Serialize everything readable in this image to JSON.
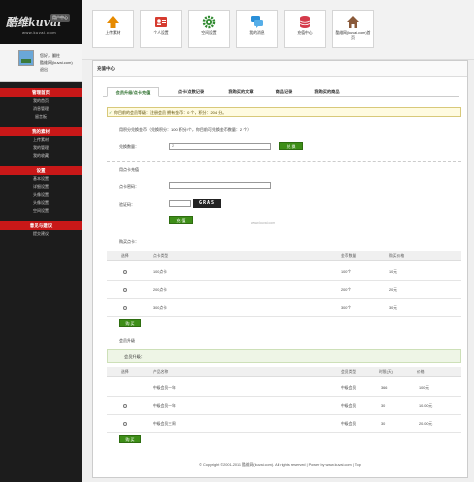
{
  "sidebar": {
    "logo": "酷维kuvai",
    "logo_sub": "www.kuvai.com",
    "user_center_tag": "用户中心",
    "user": {
      "greeting": "您好，翻柱",
      "name": "酷维网(kuvai.com)",
      "logout": "退出"
    },
    "groups": [
      {
        "title": "管理首页",
        "items": [
          "我的首页",
          "消息管理",
          "留言板"
        ]
      },
      {
        "title": "我的素材",
        "items": [
          "上传素材",
          "我的管理",
          "我的收藏"
        ]
      },
      {
        "title": "设置",
        "items": [
          "基本设置",
          "详细设置",
          "头像设置",
          "头像设置",
          "空间设置"
        ]
      },
      {
        "title": "意见与建议",
        "items": [
          "提交建议"
        ]
      }
    ]
  },
  "topbar": {
    "tiles": [
      {
        "label": "上传素材",
        "icon": "upload-arrow-icon",
        "color": "#e68a00"
      },
      {
        "label": "个人设置",
        "icon": "id-card-icon",
        "color": "#d63b2f"
      },
      {
        "label": "空间设置",
        "icon": "gear-icon",
        "color": "#2f8a2f"
      },
      {
        "label": "我的消息",
        "icon": "chat-bubble-icon",
        "color": "#2a8fd8"
      },
      {
        "label": "充值中心",
        "icon": "database-icon",
        "color": "#d43a4a"
      },
      {
        "label": "酷维网(kuvai.com)首页",
        "icon": "home-icon",
        "color": "#8a5a3a"
      }
    ]
  },
  "content": {
    "title": "充值中心",
    "tabs": [
      "会员升级/点卡充值",
      "点卡/点数记录",
      "我购买的文章",
      "商品记录",
      "我购买的商品"
    ],
    "notice": "你目前的会员等级：注册会员 拥有金币：0 个，积分：204 分。",
    "exchange": {
      "title": "用积分兑换金币（兑换积分：100 积分/个，你目前可兑换金币数量：2 个）",
      "label": "兑换数量：",
      "value": "2",
      "button": "兑 换"
    },
    "card": {
      "title": "用点卡充值",
      "card_label": "点卡密码：",
      "captcha_label": "验证码：",
      "captcha_text": "GRAS",
      "button": "充 值"
    },
    "buy_card": {
      "title": "购买点卡：",
      "headers": [
        "选择",
        "点卡类型",
        "金币数量",
        "购买价格"
      ],
      "rows": [
        {
          "type": "100点卡",
          "coins": "100个",
          "price": "10元"
        },
        {
          "type": "200点卡",
          "coins": "200个",
          "price": "20元"
        },
        {
          "type": "300点卡",
          "coins": "300个",
          "price": "30元"
        }
      ],
      "button": "购 买"
    },
    "member_upgrade": {
      "title": "会员升级",
      "bar_label": "会员升级：",
      "headers": [
        "选择",
        "产品名称",
        "会员类型",
        "时限(天)",
        "价格"
      ],
      "rows": [
        {
          "name": "中级会员一年",
          "type": "中级会员",
          "days": "366",
          "price": "100元"
        },
        {
          "name": "中级会员一年",
          "type": "中级会员",
          "days": "30",
          "price": "10.00元"
        },
        {
          "name": "中级会员三周",
          "type": "中级会员",
          "days": "30",
          "price": "20.00元"
        }
      ],
      "button": "购 买"
    },
    "watermark": "www.kuvai.com"
  },
  "footer": "© Copyright ©2001-2011 酷维网(kuvai.com). All rights reserved | Power by www.kuvai.com | Top"
}
